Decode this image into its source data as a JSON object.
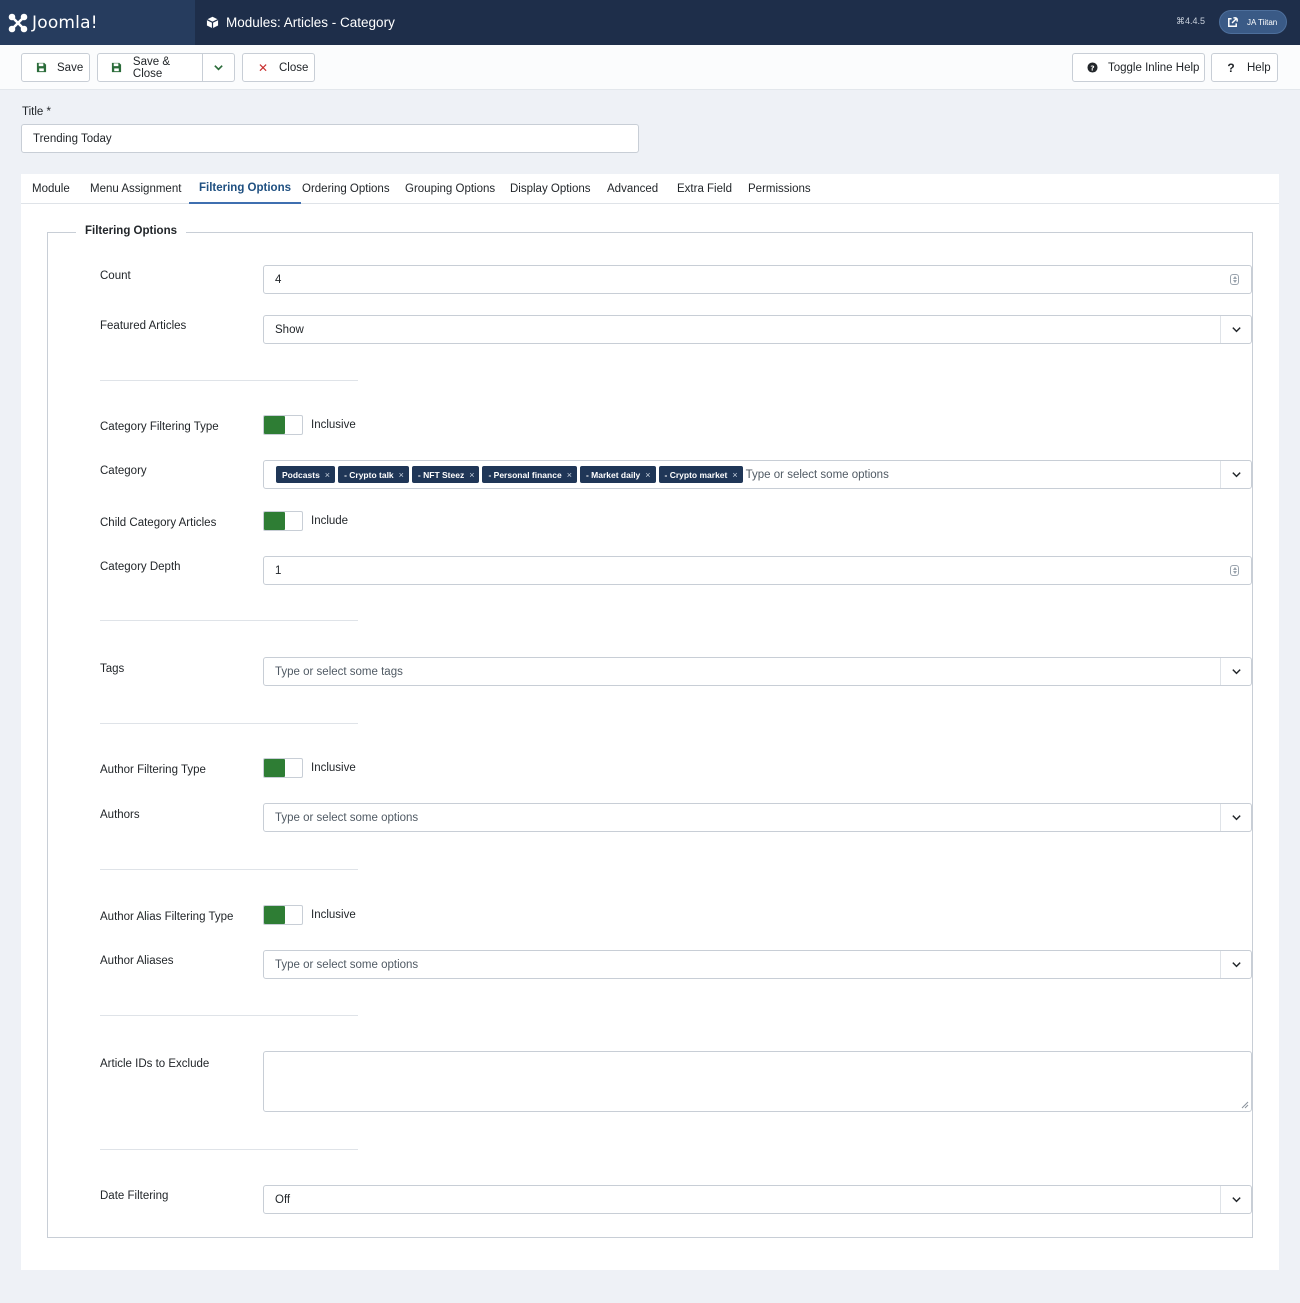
{
  "header": {
    "brand": "Joomla!",
    "title": "Modules: Articles - Category",
    "version": "⌘4.4.5",
    "user": "JA Tiitan"
  },
  "toolbar": {
    "save": "Save",
    "save_close": "Save & Close",
    "close": "Close",
    "toggle_help": "Toggle Inline Help",
    "help": "Help"
  },
  "form": {
    "title_label": "Title *",
    "title_value": "Trending Today"
  },
  "tabs": [
    "Module",
    "Menu Assignment",
    "Filtering Options",
    "Ordering Options",
    "Grouping Options",
    "Display Options",
    "Advanced",
    "Extra Field",
    "Permissions"
  ],
  "active_tab": "Filtering Options",
  "fieldset": {
    "legend": "Filtering Options",
    "count_label": "Count",
    "count_value": "4",
    "featured_label": "Featured Articles",
    "featured_value": "Show",
    "cat_filter_type_label": "Category Filtering Type",
    "cat_filter_type_value": "Inclusive",
    "category_label": "Category",
    "category_chips": [
      "Podcasts",
      "- Crypto talk",
      "- NFT Steez",
      "- Personal finance",
      "- Market daily",
      "- Crypto market"
    ],
    "category_placeholder": "Type or select some options",
    "child_label": "Child Category Articles",
    "child_value": "Include",
    "depth_label": "Category Depth",
    "depth_value": "1",
    "tags_label": "Tags",
    "tags_placeholder": "Type or select some tags",
    "author_filter_label": "Author Filtering Type",
    "author_filter_value": "Inclusive",
    "authors_label": "Authors",
    "authors_placeholder": "Type or select some options",
    "alias_filter_label": "Author Alias Filtering Type",
    "alias_filter_value": "Inclusive",
    "aliases_label": "Author Aliases",
    "aliases_placeholder": "Type or select some options",
    "exclude_label": "Article IDs to Exclude",
    "date_label": "Date Filtering",
    "date_value": "Off"
  },
  "colors": {
    "header_bg": "#1e2e4a",
    "switch_on": "#2e7d34",
    "chip_bg": "#1f3657",
    "active_tab": "#1e4f80"
  }
}
